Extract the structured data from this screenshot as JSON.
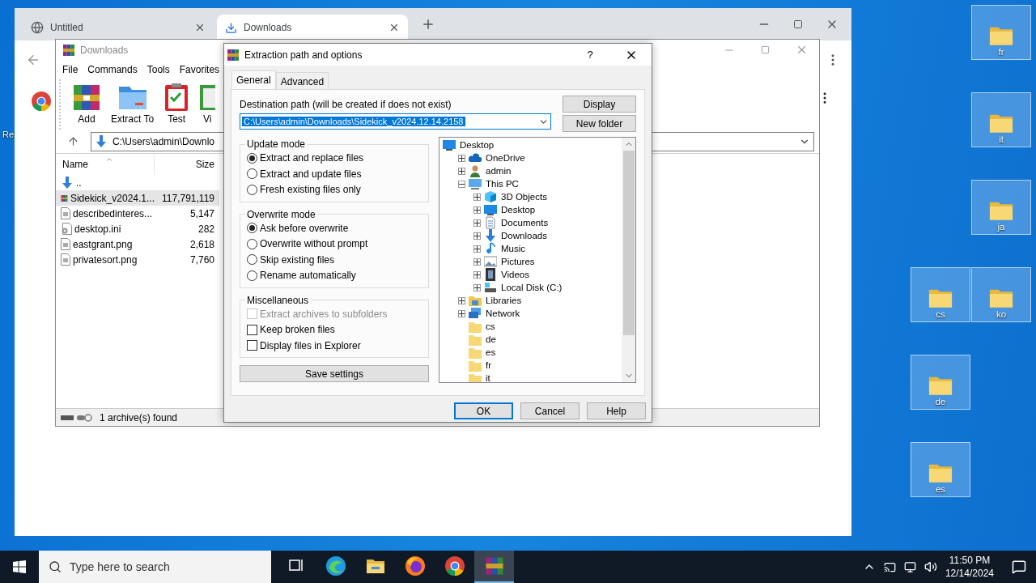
{
  "browser": {
    "tabs": [
      {
        "kind": "page",
        "title": "Untitled",
        "selected": false
      },
      {
        "kind": "download",
        "title": "Downloads",
        "selected": true
      }
    ]
  },
  "winrar": {
    "title": "Downloads",
    "menu": [
      "File",
      "Commands",
      "Tools",
      "Favorites"
    ],
    "tools": [
      {
        "kind": "add",
        "label": "Add"
      },
      {
        "kind": "extract",
        "label": "Extract To"
      },
      {
        "kind": "test",
        "label": "Test"
      },
      {
        "kind": "view",
        "label": "Vi"
      }
    ],
    "address": "C:\\Users\\admin\\Downlo",
    "columns": [
      "Name",
      "Size"
    ],
    "files": [
      {
        "kind": "up",
        "name": "..",
        "selected": false
      },
      {
        "kind": "archive",
        "name": "Sidekick_v2024.1...",
        "size": "117,791,119",
        "selected": true
      },
      {
        "kind": "file",
        "name": "describedinteres...",
        "size": "5,147",
        "selected": false
      },
      {
        "kind": "settings",
        "name": "desktop.ini",
        "size": "282",
        "selected": false
      },
      {
        "kind": "file",
        "name": "eastgrant.png",
        "size": "2,618",
        "selected": false
      },
      {
        "kind": "file",
        "name": "privatesort.png",
        "size": "7,760",
        "selected": false
      }
    ],
    "status": "1 archive(s) found"
  },
  "dialog": {
    "title": "Extraction path and options",
    "help": "?",
    "tabs": [
      {
        "label": "General",
        "selected": true
      },
      {
        "label": "Advanced",
        "selected": false
      }
    ],
    "path_label": "Destination path (will be created if does not exist)",
    "path": "C:\\Users\\admin\\Downloads\\Sidekick_v2024.12.14.2158",
    "side_buttons": [
      "Display",
      "New folder"
    ],
    "groups": [
      {
        "kind": "radio",
        "title": "Update mode",
        "options": [
          {
            "label": "Extract and replace files",
            "selected": true
          },
          {
            "label": "Extract and update files",
            "selected": false
          },
          {
            "label": "Fresh existing files only",
            "selected": false
          }
        ]
      },
      {
        "kind": "radio",
        "title": "Overwrite mode",
        "options": [
          {
            "label": "Ask before overwrite",
            "selected": true
          },
          {
            "label": "Overwrite without prompt",
            "selected": false
          },
          {
            "label": "Skip existing files",
            "selected": false
          },
          {
            "label": "Rename automatically",
            "selected": false
          }
        ]
      },
      {
        "kind": "check",
        "title": "Miscellaneous",
        "options": [
          {
            "label": "Extract archives to subfolders",
            "checked": false,
            "disabled": true
          },
          {
            "label": "Keep broken files",
            "checked": false,
            "disabled": false
          },
          {
            "label": "Display files in Explorer",
            "checked": false,
            "disabled": false
          }
        ]
      }
    ],
    "save_button": "Save settings",
    "tree": [
      {
        "kind": "desktop",
        "label": "Desktop",
        "children": [
          {
            "kind": "cloud",
            "label": "OneDrive",
            "expanded": false
          },
          {
            "kind": "user",
            "label": "admin",
            "expanded": false
          },
          {
            "kind": "pc",
            "label": "This PC",
            "expanded": true,
            "children": [
              {
                "kind": "cube",
                "label": "3D Objects",
                "expanded": false
              },
              {
                "kind": "desktop",
                "label": "Desktop",
                "expanded": false
              },
              {
                "kind": "documents",
                "label": "Documents",
                "expanded": false
              },
              {
                "kind": "download",
                "label": "Downloads",
                "expanded": false
              },
              {
                "kind": "music",
                "label": "Music",
                "expanded": false
              },
              {
                "kind": "pictures",
                "label": "Pictures",
                "expanded": false
              },
              {
                "kind": "videos",
                "label": "Videos",
                "expanded": false
              },
              {
                "kind": "disk",
                "label": "Local Disk (C:)",
                "expanded": false
              }
            ]
          },
          {
            "kind": "libraries",
            "label": "Libraries",
            "expanded": false
          },
          {
            "kind": "network",
            "label": "Network",
            "expanded": false
          },
          {
            "kind": "folder",
            "label": "cs"
          },
          {
            "kind": "folder",
            "label": "de"
          },
          {
            "kind": "folder",
            "label": "es"
          },
          {
            "kind": "folder",
            "label": "fr"
          },
          {
            "kind": "folder",
            "label": "it"
          }
        ]
      }
    ],
    "buttons": [
      {
        "label": "OK",
        "default": true
      },
      {
        "label": "Cancel",
        "default": false
      },
      {
        "label": "Help",
        "default": false
      }
    ]
  },
  "left_icons": [
    {
      "label": "Re"
    }
  ],
  "desktop_icons": [
    {
      "label": "fr"
    },
    {
      "label": "it"
    },
    {
      "label": "ja"
    },
    {
      "label": "cs"
    },
    {
      "label": "ko"
    },
    {
      "label": "de"
    },
    {
      "label": "es"
    }
  ],
  "taskbar": {
    "search": {
      "placeholder": "Type here to search"
    },
    "apps": [
      {
        "kind": "taskview",
        "active": false
      },
      {
        "kind": "edge",
        "active": false
      },
      {
        "kind": "explorer",
        "active": false
      },
      {
        "kind": "firefox",
        "active": false
      },
      {
        "kind": "chrome",
        "active": false
      },
      {
        "kind": "winrar",
        "active": true
      }
    ],
    "time": "11:50 PM",
    "date": "12/14/2024"
  }
}
